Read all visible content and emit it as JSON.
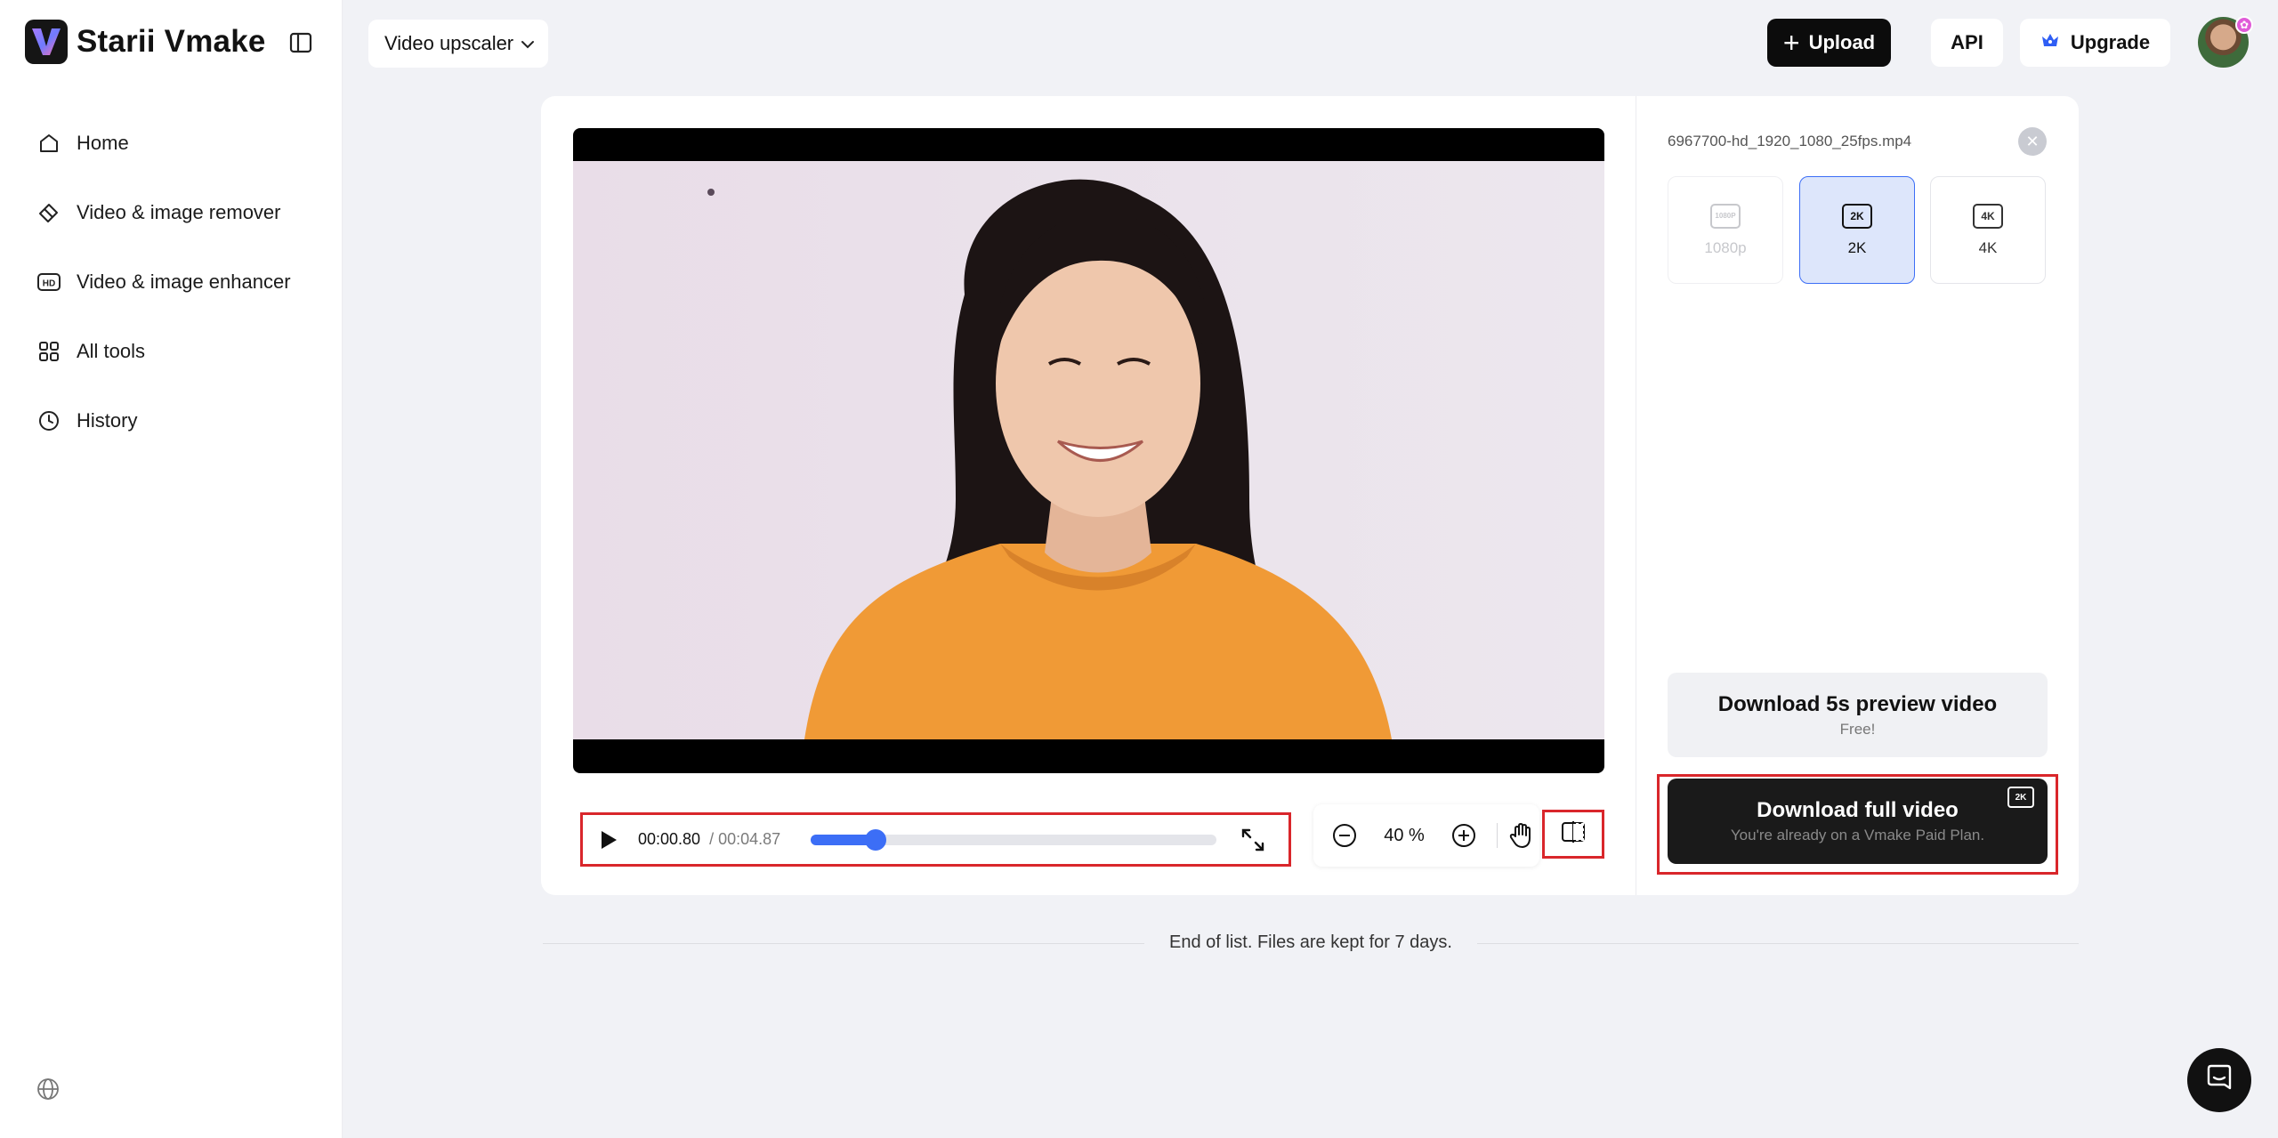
{
  "brand": {
    "name": "Starii Vmake"
  },
  "sidebar": {
    "items": [
      {
        "label": "Home",
        "icon": "home-icon"
      },
      {
        "label": "Video & image remover",
        "icon": "eraser-icon"
      },
      {
        "label": "Video & image enhancer",
        "icon": "hd-icon"
      },
      {
        "label": "All tools",
        "icon": "grid-icon"
      },
      {
        "label": "History",
        "icon": "clock-icon"
      }
    ],
    "language_icon": "globe-icon"
  },
  "topbar": {
    "tool_select": "Video upscaler",
    "upload_label": "Upload",
    "api_label": "API",
    "upgrade_label": "Upgrade",
    "avatar_badge": "✿"
  },
  "player": {
    "current_time": "00:00.80",
    "total_time": "/ 00:04.87",
    "progress": 0.16,
    "zoom": "40 %"
  },
  "panel": {
    "file_name": "6967700-hd_1920_1080_25fps.mp4",
    "resolutions": [
      {
        "chip": "1080P",
        "label": "1080p",
        "state": "disabled"
      },
      {
        "chip": "2K",
        "label": "2K",
        "state": "selected"
      },
      {
        "chip": "4K",
        "label": "4K",
        "state": "available"
      }
    ],
    "preview_download": {
      "label": "Download 5s preview video",
      "sub": "Free!"
    },
    "full_download": {
      "label": "Download full video",
      "sub": "You're already on a Vmake Paid Plan.",
      "badge": "2K"
    }
  },
  "footer": {
    "end_text": "End of list. Files are kept for 7 days."
  },
  "colors": {
    "accent": "#3c6ef6",
    "highlight": "#d9262b",
    "dark": "#1a1a1a"
  }
}
